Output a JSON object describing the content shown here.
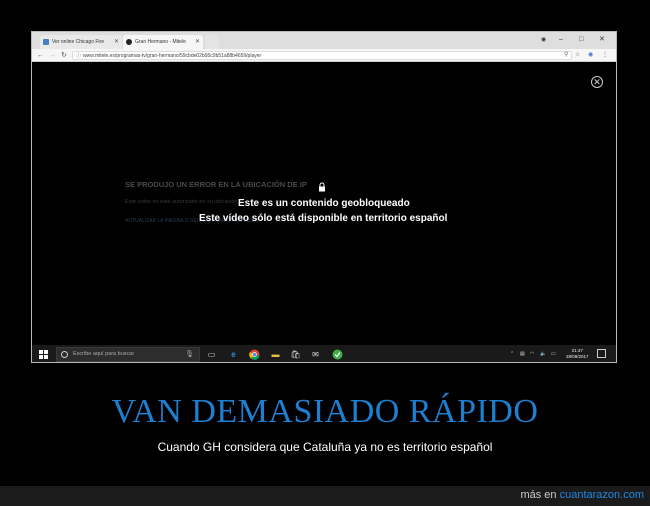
{
  "browser": {
    "tabs": [
      {
        "label": "Ver online Chicago Fire",
        "active": false,
        "favicon_color": "#4a7fc8"
      },
      {
        "label": "Gran Hermano - Mitele",
        "active": true,
        "favicon_color": "#222222"
      }
    ],
    "url": "www.mitele.es/programas-tv/gran-hermano/59cbde02b95c9b51a88b4659/player",
    "window_controls": {
      "minimize": "–",
      "maximize": "□",
      "close": "✕"
    },
    "user_icon": "user-icon"
  },
  "player": {
    "error_heading": "SE PRODUJO UN ERROR EN LA UBICACIÓN DE IP",
    "error_sub": "Este vídeo no está autorizado en su ubicación",
    "error_link": "ACTUALIZAR LA PÁGINA O SELECCIONAR OTRO VÍDEO",
    "geo_line1": "Este es un contenido geobloqueado",
    "geo_line2": "Este vídeo sólo está disponible en territorio español",
    "close_icon": "close-icon"
  },
  "taskbar": {
    "search_placeholder": "Escribe aquí para buscar",
    "clock_time": "21:47",
    "clock_date": "28/09/2017"
  },
  "meme": {
    "headline": "VAN DEMASIADO RÁPIDO",
    "caption": "Cuando GH considera que Cataluña ya no es territorio español",
    "colors": {
      "headline": "#1e7fd0",
      "link": "#1e88e5"
    }
  },
  "footer": {
    "prefix": "más en",
    "site": "cuantarazon.com"
  }
}
